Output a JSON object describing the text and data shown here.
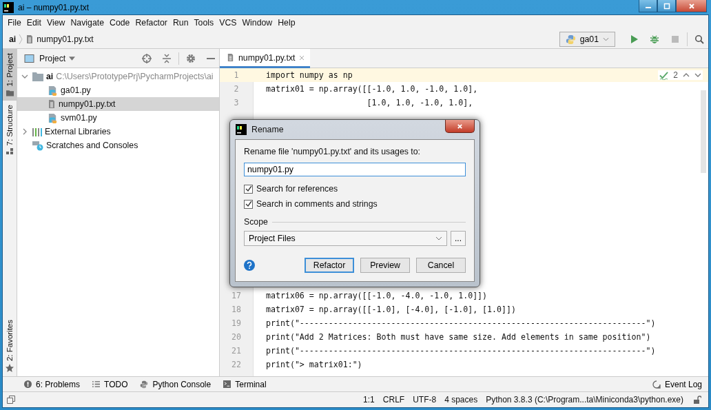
{
  "window": {
    "title": "ai – numpy01.py.txt"
  },
  "menu": [
    "File",
    "Edit",
    "View",
    "Navigate",
    "Code",
    "Refactor",
    "Run",
    "Tools",
    "VCS",
    "Window",
    "Help"
  ],
  "breadcrumbs": [
    "ai",
    "numpy01.py.txt"
  ],
  "run_config": "ga01",
  "left_stripe": [
    {
      "label": "1: Project",
      "selected": true
    },
    {
      "label": "7: Structure",
      "selected": false
    }
  ],
  "favorites": "2: Favorites",
  "project": {
    "title": "Project",
    "tree": [
      {
        "name": "ai",
        "path": "C:\\Users\\PrototypePrj\\PycharmProjects\\ai",
        "kind": "folder",
        "expanded": true,
        "children": [
          {
            "name": "ga01.py",
            "kind": "python",
            "selected": false
          },
          {
            "name": "numpy01.py.txt",
            "kind": "text",
            "selected": true
          },
          {
            "name": "svm01.py",
            "kind": "python",
            "selected": false
          }
        ]
      },
      {
        "name": "External Libraries",
        "kind": "library",
        "expanded": false
      },
      {
        "name": "Scratches and Consoles",
        "kind": "scratches"
      }
    ]
  },
  "editor": {
    "tab": {
      "label": "numpy01.py.txt",
      "selected": true
    },
    "inspections": "2",
    "lines": [
      {
        "number": "1",
        "code": "import numpy as np",
        "current": true
      },
      {
        "number": "2",
        "code": "matrix01 = np.array([[-1.0, 1.0, -1.0, 1.0],",
        "current": false
      },
      {
        "number": "3",
        "code": "                     [1.0, 1.0, -1.0, 1.0],",
        "current": false
      },
      {
        "number": "17",
        "code": "matrix06 = np.array([[-1.0, -4.0, -1.0, 1.0]])",
        "current": false
      },
      {
        "number": "18",
        "code": "matrix07 = np.array([[-1.0], [-4.0], [-1.0], [1.0]])",
        "current": false
      },
      {
        "number": "19",
        "code": "print(\"------------------------------------------------------------------------\")",
        "current": false
      },
      {
        "number": "20",
        "code": "print(\"Add 2 Matrices: Both must have same size. Add elements in same position\")",
        "current": false
      },
      {
        "number": "21",
        "code": "print(\"------------------------------------------------------------------------\")",
        "current": false
      },
      {
        "number": "22",
        "code": "print(\"> matrix01:\")",
        "current": false
      }
    ]
  },
  "dialog": {
    "title": "Rename",
    "prompt": "Rename file 'numpy01.py.txt' and its usages to:",
    "value": "numpy01.py",
    "checkboxes": [
      {
        "label": "Search for references",
        "checked": true
      },
      {
        "label": "Search in comments and strings",
        "checked": true
      }
    ],
    "scope_label": "Scope",
    "scope_value": "Project Files",
    "more": "...",
    "buttons": [
      {
        "label": "Refactor",
        "default": true
      },
      {
        "label": "Preview",
        "default": false
      },
      {
        "label": "Cancel",
        "default": false
      }
    ]
  },
  "bottom_tools": [
    {
      "label": "6: Problems",
      "kind": "problems"
    },
    {
      "label": "TODO",
      "kind": "todo"
    },
    {
      "label": "Python Console",
      "kind": "console"
    },
    {
      "label": "Terminal",
      "kind": "terminal"
    }
  ],
  "event_log": "Event Log",
  "status_bar": [
    "1:1",
    "CRLF",
    "UTF-8",
    "4 spaces",
    "Python 3.8.3 (C:\\Program...ta\\Miniconda3\\python.exe)"
  ]
}
